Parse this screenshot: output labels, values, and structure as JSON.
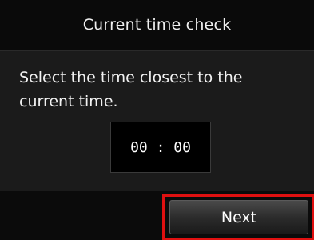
{
  "screen": {
    "title": "Current time check",
    "instruction": "Select the time closest to the current time.",
    "time_value": "00 : 00"
  },
  "footer": {
    "next_label": "Next"
  },
  "colors": {
    "background": "#000000",
    "panel": "#1b1b1b",
    "highlight": "#e01010"
  }
}
